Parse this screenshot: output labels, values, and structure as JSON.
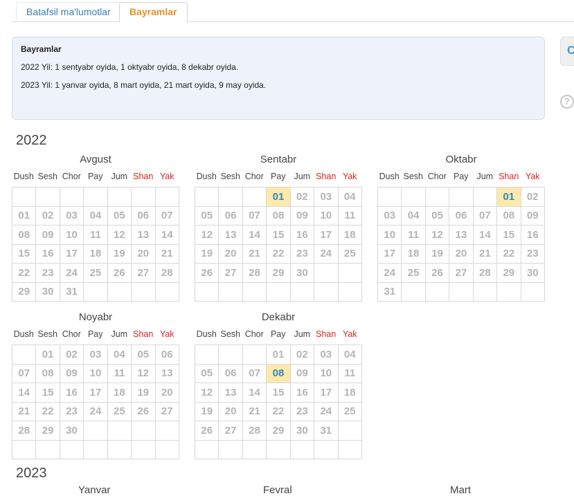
{
  "tabs": [
    {
      "label": "Batafsil ma'lumotlar"
    },
    {
      "label": "Bayramlar"
    }
  ],
  "info": {
    "heading": "Bayramlar",
    "lines": [
      "2022 Yil: 1 sentyabr oyida, 1 oktyabr oyida, 8 dekabr oyida.",
      "2023 Yil: 1 yanvar oyida, 8 mart oyida, 21 mart oyida, 9 may oyida."
    ]
  },
  "side_button_label": "C",
  "help_icon": "?",
  "weekdays": [
    "Dush",
    "Sesh",
    "Chor",
    "Pay",
    "Jum",
    "Shan",
    "Yak"
  ],
  "years": [
    {
      "label": "2022",
      "months": [
        {
          "name": "Avgust",
          "weeks": [
            [
              "",
              "",
              "",
              "",
              "",
              "",
              ""
            ],
            [
              "01",
              "02",
              "03",
              "04",
              "05",
              "06",
              "07"
            ],
            [
              "08",
              "09",
              "10",
              "11",
              "12",
              "13",
              "14"
            ],
            [
              "15",
              "16",
              "17",
              "18",
              "19",
              "20",
              "21"
            ],
            [
              "22",
              "23",
              "24",
              "25",
              "26",
              "27",
              "28"
            ],
            [
              "29",
              "30",
              "31",
              "",
              "",
              "",
              ""
            ]
          ],
          "holidays": []
        },
        {
          "name": "Sentabr",
          "weeks": [
            [
              "",
              "",
              "",
              "01",
              "02",
              "03",
              "04"
            ],
            [
              "05",
              "06",
              "07",
              "08",
              "09",
              "10",
              "11"
            ],
            [
              "12",
              "13",
              "14",
              "15",
              "16",
              "17",
              "18"
            ],
            [
              "19",
              "20",
              "21",
              "22",
              "23",
              "24",
              "25"
            ],
            [
              "26",
              "27",
              "28",
              "29",
              "30",
              "",
              ""
            ],
            [
              "",
              "",
              "",
              "",
              "",
              "",
              ""
            ]
          ],
          "holidays": [
            "01"
          ]
        },
        {
          "name": "Oktabr",
          "weeks": [
            [
              "",
              "",
              "",
              "",
              "",
              "01",
              "02"
            ],
            [
              "03",
              "04",
              "05",
              "06",
              "07",
              "08",
              "09"
            ],
            [
              "10",
              "11",
              "12",
              "13",
              "14",
              "15",
              "16"
            ],
            [
              "17",
              "18",
              "19",
              "20",
              "21",
              "22",
              "23"
            ],
            [
              "24",
              "25",
              "26",
              "27",
              "28",
              "29",
              "30"
            ],
            [
              "31",
              "",
              "",
              "",
              "",
              "",
              ""
            ]
          ],
          "holidays": [
            "01"
          ]
        },
        {
          "name": "Noyabr",
          "weeks": [
            [
              "",
              "01",
              "02",
              "03",
              "04",
              "05",
              "06"
            ],
            [
              "07",
              "08",
              "09",
              "10",
              "11",
              "12",
              "13"
            ],
            [
              "14",
              "15",
              "16",
              "17",
              "18",
              "19",
              "20"
            ],
            [
              "21",
              "22",
              "23",
              "24",
              "25",
              "26",
              "27"
            ],
            [
              "28",
              "29",
              "30",
              "",
              "",
              "",
              ""
            ],
            [
              "",
              "",
              "",
              "",
              "",
              "",
              ""
            ]
          ],
          "holidays": []
        },
        {
          "name": "Dekabr",
          "weeks": [
            [
              "",
              "",
              "",
              "01",
              "02",
              "03",
              "04"
            ],
            [
              "05",
              "06",
              "07",
              "08",
              "09",
              "10",
              "11"
            ],
            [
              "12",
              "13",
              "14",
              "15",
              "16",
              "17",
              "18"
            ],
            [
              "19",
              "20",
              "21",
              "22",
              "23",
              "24",
              "25"
            ],
            [
              "26",
              "27",
              "28",
              "29",
              "30",
              "31",
              ""
            ],
            [
              "",
              "",
              "",
              "",
              "",
              "",
              ""
            ]
          ],
          "holidays": [
            "08"
          ]
        }
      ]
    },
    {
      "label": "2023",
      "months": [
        {
          "name": "Yanvar"
        },
        {
          "name": "Fevral"
        },
        {
          "name": "Mart"
        }
      ]
    }
  ]
}
